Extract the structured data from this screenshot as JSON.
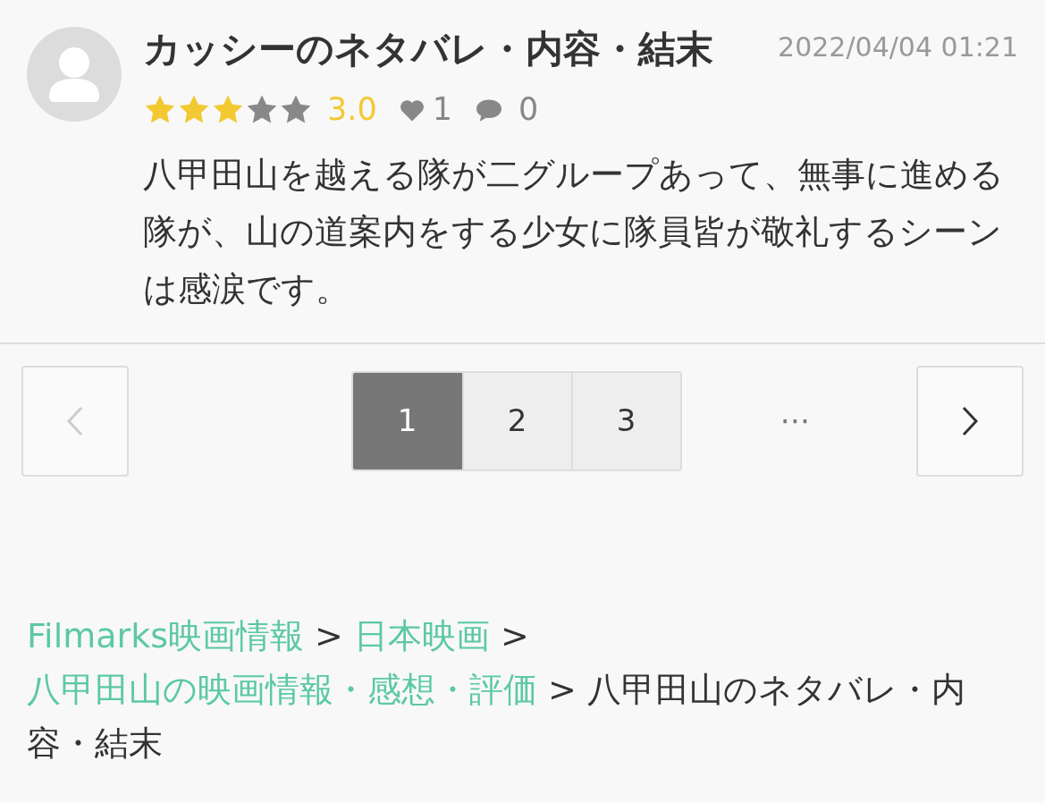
{
  "review": {
    "title": "カッシーのネタバレ・内容・結末",
    "date": "2022/04/04 01:21",
    "stars": 3,
    "score": "3.0",
    "likes": "1",
    "comments": "0",
    "body": "八甲田山を越える隊が二グループあって、無事に進める隊が、山の道案内をする少女に隊員皆が敬礼するシーンは感涙です。"
  },
  "pagination": {
    "prev": {
      "disabled": true
    },
    "next": {
      "disabled": false
    },
    "pages": [
      {
        "label": "1",
        "selected": true
      },
      {
        "label": "2",
        "selected": false
      },
      {
        "label": "3",
        "selected": false
      }
    ],
    "ellipsis": "⋯"
  },
  "breadcrumbs": [
    {
      "label": "Filmarks映画情報",
      "link": true
    },
    {
      "separator": ">",
      "label": "日本映画",
      "link": true
    },
    {
      "separator": ">",
      "label": "八甲田山の映画情報・感想・評価",
      "link": true
    },
    {
      "separator": ">",
      "label": "八甲田山のネタバレ・内容・結末",
      "link": false
    }
  ]
}
